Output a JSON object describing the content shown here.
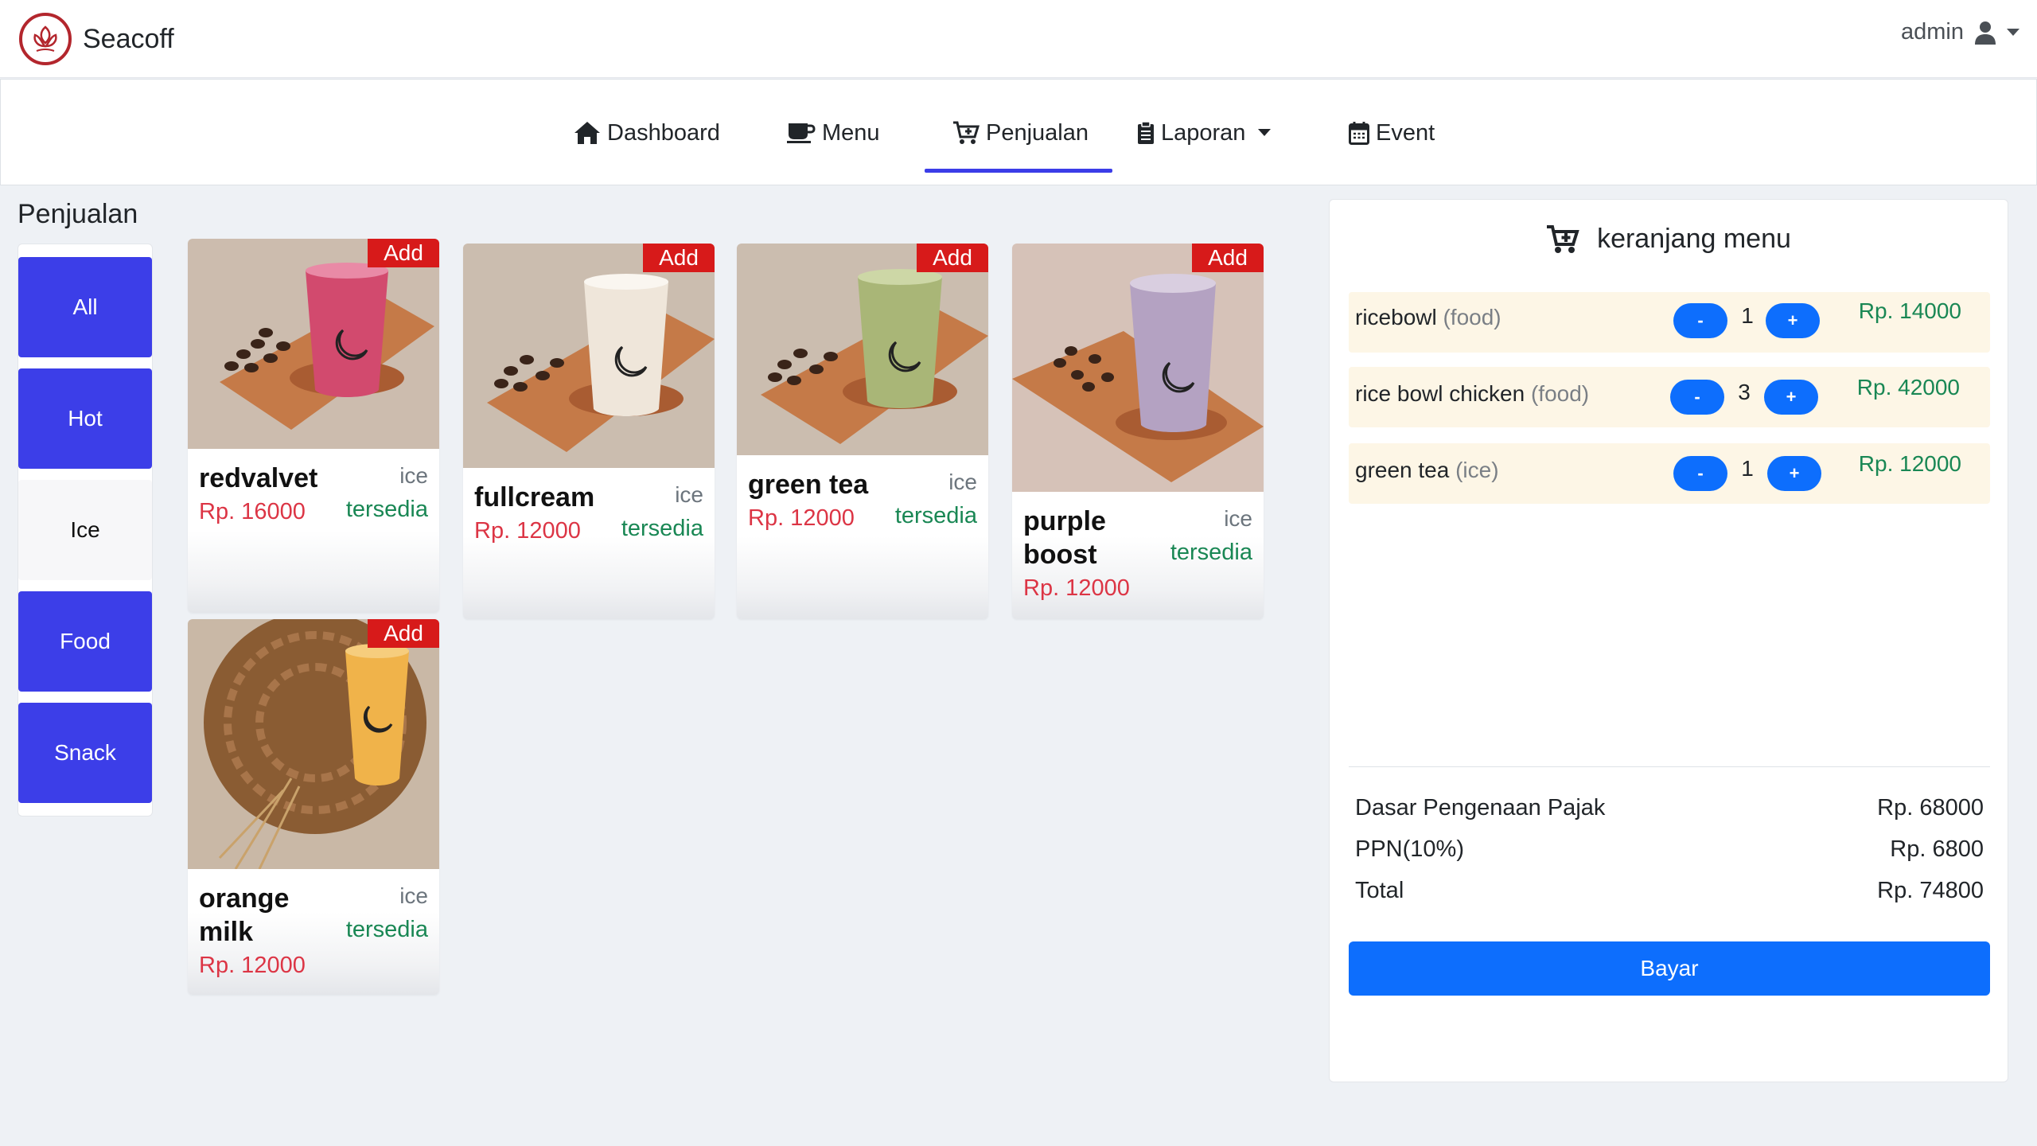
{
  "brand": {
    "name": "Seacoff"
  },
  "user": {
    "name": "admin"
  },
  "nav": {
    "dashboard": "Dashboard",
    "menu": "Menu",
    "penjualan": "Penjualan",
    "laporan": "Laporan",
    "event": "Event"
  },
  "page": {
    "title": "Penjualan"
  },
  "categories": [
    {
      "label": "All",
      "active": true
    },
    {
      "label": "Hot",
      "active": true
    },
    {
      "label": "Ice",
      "active": false
    },
    {
      "label": "Food",
      "active": true
    },
    {
      "label": "Snack",
      "active": true
    }
  ],
  "products": [
    {
      "name": "redvalvet",
      "category": "ice",
      "status": "tersedia",
      "price": "Rp. 16000",
      "add": "Add"
    },
    {
      "name": "fullcream",
      "category": "ice",
      "status": "tersedia",
      "price": "Rp. 12000",
      "add": "Add"
    },
    {
      "name": "green tea",
      "category": "ice",
      "status": "tersedia",
      "price": "Rp. 12000",
      "add": "Add"
    },
    {
      "name": "purple boost",
      "category": "ice",
      "status": "tersedia",
      "price": "Rp. 12000",
      "add": "Add"
    },
    {
      "name": "orange milk",
      "category": "ice",
      "status": "tersedia",
      "price": "Rp. 12000",
      "add": "Add"
    }
  ],
  "cart": {
    "title": "keranjang menu",
    "items": [
      {
        "name": "ricebowl",
        "type": "(food)",
        "qty": "1",
        "price": "Rp. 14000",
        "minus": "-",
        "plus": "+"
      },
      {
        "name": "rice bowl chicken",
        "type": "(food)",
        "qty": "3",
        "price": "Rp. 42000",
        "minus": "-",
        "plus": "+"
      },
      {
        "name": "green tea",
        "type": "(ice)",
        "qty": "1",
        "price": "Rp. 12000",
        "minus": "-",
        "plus": "+"
      }
    ],
    "summary": {
      "dpp_label": "Dasar Pengenaan Pajak",
      "dpp_value": "Rp. 68000",
      "ppn_label": "PPN(10%)",
      "ppn_value": "Rp. 6800",
      "total_label": "Total",
      "total_value": "Rp. 74800"
    },
    "pay_label": "Bayar"
  },
  "colors": {
    "accent_blue": "#3c3ee8",
    "primary": "#0d6efd",
    "danger": "#dc3545",
    "success": "#198754",
    "add_badge": "#d71a1a",
    "brand_red": "#b3262d"
  }
}
